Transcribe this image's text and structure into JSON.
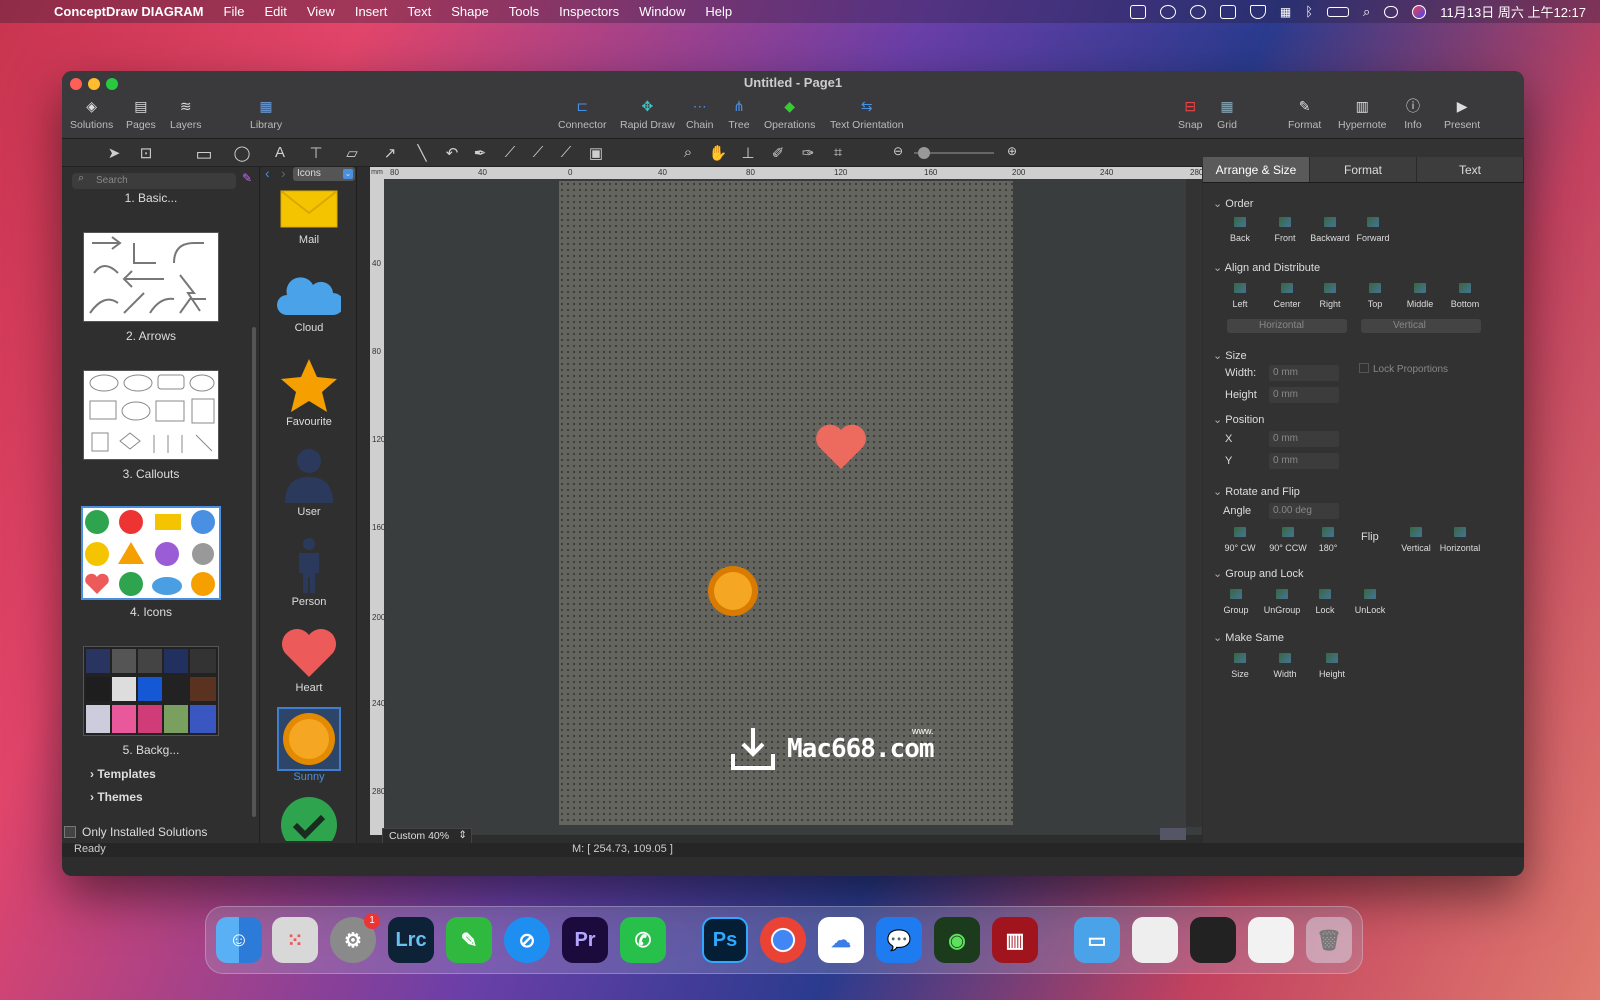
{
  "menubar": {
    "app": "ConceptDraw DIAGRAM",
    "items": [
      "File",
      "Edit",
      "View",
      "Insert",
      "Text",
      "Shape",
      "Tools",
      "Inspectors",
      "Window",
      "Help"
    ],
    "clock": "11月13日 周六 上午12:17"
  },
  "window": {
    "title": "Untitled - Page1"
  },
  "toolbar": {
    "left": [
      "Solutions",
      "Pages",
      "Layers",
      "Library"
    ],
    "center": [
      "Connector",
      "Rapid Draw",
      "Chain",
      "Tree",
      "Operations",
      "Text Orientation"
    ],
    "right": [
      "Snap",
      "Grid",
      "Format",
      "Hypernote",
      "Info",
      "Present"
    ]
  },
  "solutions": {
    "search_placeholder": "Search",
    "items": [
      "1. Basic...",
      "2. Arrows",
      "3. Callouts",
      "4. Icons",
      "5. Backg..."
    ],
    "templates": "Templates",
    "themes": "Themes",
    "only_installed": "Only Installed Solutions"
  },
  "library": {
    "selector": "Icons",
    "items": [
      "Mail",
      "Cloud",
      "Favourite",
      "User",
      "Person",
      "Heart",
      "Sunny"
    ],
    "selected": "Sunny"
  },
  "ruler": {
    "unit": "mm",
    "h_ticks": [
      "80",
      "40",
      "0",
      "40",
      "80",
      "120",
      "160",
      "200",
      "240",
      "280"
    ],
    "v_ticks": [
      "40",
      "80",
      "120",
      "160",
      "200",
      "240",
      "280"
    ]
  },
  "canvas": {
    "zoom": "Custom 40%",
    "watermark": "Mac668.com",
    "watermark_small": "www."
  },
  "status": {
    "left": "Ready",
    "coords": "M: [ 254.73, 109.05 ]"
  },
  "inspector": {
    "tabs": [
      "Arrange & Size",
      "Format",
      "Text"
    ],
    "order": {
      "title": "Order",
      "buttons": [
        "Back",
        "Front",
        "Backward",
        "Forward"
      ]
    },
    "align": {
      "title": "Align and Distribute",
      "buttons": [
        "Left",
        "Center",
        "Right",
        "Top",
        "Middle",
        "Bottom"
      ],
      "h": "Horizontal",
      "v": "Vertical"
    },
    "size": {
      "title": "Size",
      "width_label": "Width:",
      "height_label": "Height",
      "width": "0 mm",
      "height": "0 mm",
      "lock": "Lock Proportions"
    },
    "position": {
      "title": "Position",
      "x_label": "X",
      "y_label": "Y",
      "x": "0 mm",
      "y": "0 mm"
    },
    "rotate": {
      "title": "Rotate and Flip",
      "angle_label": "Angle",
      "angle": "0.00 deg",
      "buttons": [
        "90° CW",
        "90° CCW",
        "180°"
      ],
      "flip": "Flip",
      "flip_buttons": [
        "Vertical",
        "Horizontal"
      ]
    },
    "group": {
      "title": "Group and Lock",
      "buttons": [
        "Group",
        "UnGroup",
        "Lock",
        "UnLock"
      ]
    },
    "same": {
      "title": "Make Same",
      "buttons": [
        "Size",
        "Width",
        "Height"
      ]
    }
  },
  "dock": {
    "badge": "1",
    "apps": [
      "Lrc",
      "Pr",
      "Ps"
    ]
  }
}
